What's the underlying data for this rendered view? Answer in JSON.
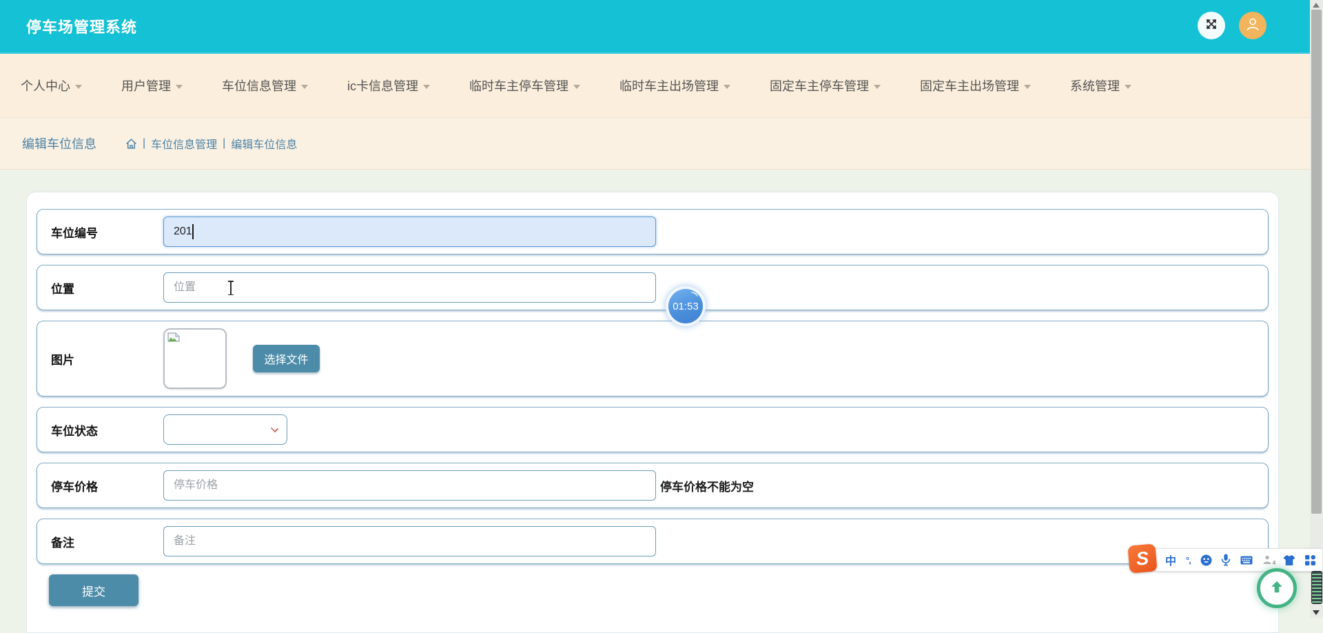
{
  "app": {
    "title": "停车场管理系统"
  },
  "nav": {
    "items": [
      "个人中心",
      "用户管理",
      "车位信息管理",
      "ic卡信息管理",
      "临时车主停车管理",
      "临时车主出场管理",
      "固定车主停车管理",
      "固定车主出场管理",
      "系统管理"
    ]
  },
  "breadcrumb": {
    "page_title": "编辑车位信息",
    "sep": "|",
    "section": "车位信息管理",
    "current": "编辑车位信息"
  },
  "form": {
    "fields": {
      "space_number": {
        "label": "车位编号",
        "value": "201"
      },
      "location": {
        "label": "位置",
        "placeholder": "位置"
      },
      "image": {
        "label": "图片",
        "choose_file": "选择文件"
      },
      "status": {
        "label": "车位状态",
        "selected_value": ""
      },
      "price": {
        "label": "停车价格",
        "placeholder": "停车价格",
        "error": "停车价格不能为空"
      },
      "remark": {
        "label": "备注",
        "placeholder": "备注"
      }
    },
    "submit": "提交"
  },
  "overlay": {
    "recording_timer": "01:53"
  },
  "ime": {
    "logo_text": "S",
    "mode_label": "中",
    "punct_label": "°,",
    "person_badge": "4"
  },
  "colors": {
    "header_bg": "#15c1d4",
    "nav_bg": "#fbeedc",
    "breadcrumb_bg": "#faf1e2",
    "page_bg": "#eef3ea",
    "accent_button": "#4d8ca9",
    "row_border": "#7fa9c3",
    "focused_input_bg": "#dbe9fb",
    "avatar_bg": "#f2b45c",
    "timer_blue": "#4c90dd",
    "back_to_top_green": "#44b385",
    "ime_blue": "#2a6fd0",
    "sogou_orange": "#f3652c"
  }
}
